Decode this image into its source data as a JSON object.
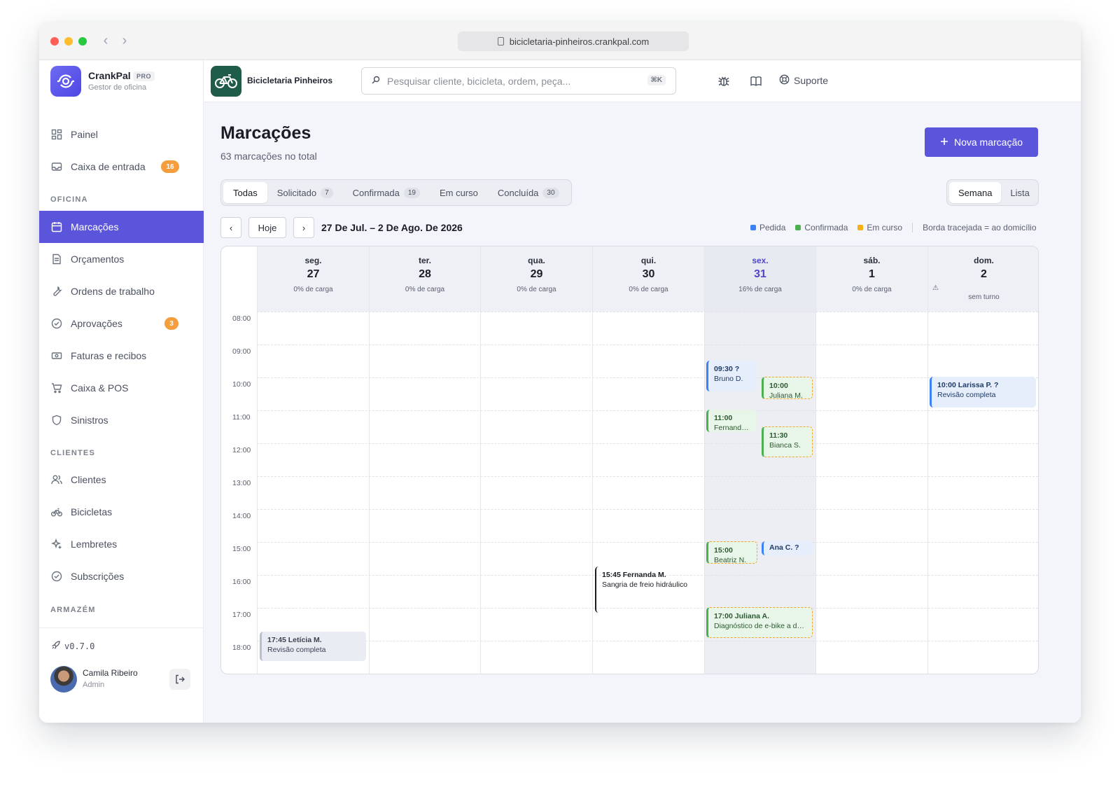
{
  "browser": {
    "url": "bicicletaria-pinheiros.crankpal.com"
  },
  "brand": {
    "name": "CrankPal",
    "tier": "PRO",
    "subtitle": "Gestor de oficina"
  },
  "sidebar": {
    "items": [
      {
        "label": "Painel",
        "icon": "dashboard-icon"
      },
      {
        "label": "Caixa de entrada",
        "icon": "inbox-icon",
        "badge": "16"
      },
      {
        "label": "Marcações",
        "icon": "calendar-icon",
        "active": true
      },
      {
        "label": "Orçamentos",
        "icon": "document-icon"
      },
      {
        "label": "Ordens de trabalho",
        "icon": "wrench-icon"
      },
      {
        "label": "Aprovações",
        "icon": "check-circle-icon",
        "badge": "3"
      },
      {
        "label": "Faturas e recibos",
        "icon": "banknote-icon"
      },
      {
        "label": "Caixa & POS",
        "icon": "cart-icon"
      },
      {
        "label": "Sinistros",
        "icon": "shield-icon"
      },
      {
        "label": "Clientes",
        "icon": "users-icon"
      },
      {
        "label": "Bicicletas",
        "icon": "bike-icon"
      },
      {
        "label": "Lembretes",
        "icon": "sparkles-icon"
      },
      {
        "label": "Subscrições",
        "icon": "check-circle-icon"
      }
    ],
    "sections": {
      "oficina": "OFICINA",
      "clientes": "CLIENTES",
      "armazem": "ARMAZÉM"
    },
    "version": "v0.7.0",
    "user": {
      "name": "Camila Ribeiro",
      "role": "Admin"
    }
  },
  "topbar": {
    "shop_name": "Bicicletaria Pinheiros",
    "search_placeholder": "Pesquisar cliente, bicicleta, ordem, peça...",
    "search_shortcut": "⌘K",
    "support_label": "Suporte"
  },
  "page": {
    "title": "Marcações",
    "subtitle": "63 marcações no total",
    "new_button": "Nova marcação",
    "filters": [
      {
        "label": "Todas",
        "active": true
      },
      {
        "label": "Solicitado",
        "count": "7"
      },
      {
        "label": "Confirmada",
        "count": "19"
      },
      {
        "label": "Em curso"
      },
      {
        "label": "Concluída",
        "count": "30"
      }
    ],
    "views": {
      "week": "Semana",
      "list": "Lista"
    },
    "today_button": "Hoje",
    "prev": "‹",
    "next": "›",
    "range": "27 De Jul. – 2 De Ago. De 2026",
    "legend": {
      "requested": "Pedida",
      "confirmed": "Confirmada",
      "in_progress": "Em curso",
      "note": "Borda tracejada = ao domicílio"
    },
    "colors": {
      "requested": "#3b82f6",
      "confirmed": "#4caf50",
      "in_progress": "#f5b014",
      "accent": "#5b55dc"
    }
  },
  "calendar": {
    "days": [
      {
        "name": "seg.",
        "date": "27",
        "load": "0% de carga"
      },
      {
        "name": "ter.",
        "date": "28",
        "load": "0% de carga"
      },
      {
        "name": "qua.",
        "date": "29",
        "load": "0% de carga"
      },
      {
        "name": "qui.",
        "date": "30",
        "load": "0% de carga"
      },
      {
        "name": "sex.",
        "date": "31",
        "load": "16% de carga",
        "today": true
      },
      {
        "name": "sáb.",
        "date": "1",
        "load": "0% de carga"
      },
      {
        "name": "dom.",
        "date": "2",
        "load": "sem turno",
        "warning": "⚠"
      }
    ],
    "hours": [
      "08:00",
      "09:00",
      "10:00",
      "11:00",
      "12:00",
      "13:00",
      "14:00",
      "15:00",
      "16:00",
      "17:00",
      "18:00"
    ],
    "events": [
      {
        "title": "17:45 Letícia M.",
        "sub": "Revisão completa"
      },
      {
        "title": "15:45 Fernanda M.",
        "sub": "Sangria de freio hidráulico"
      },
      {
        "title": "09:30 ?",
        "sub": "Bruno D."
      },
      {
        "title": "10:00",
        "sub": "Juliana M."
      },
      {
        "title": "11:00",
        "sub": "Fernanda ..."
      },
      {
        "title": "11:30",
        "sub": "Bianca S."
      },
      {
        "title": "15:00",
        "sub": "Beatriz N."
      },
      {
        "title": "Ana C. ?",
        "sub": ""
      },
      {
        "title": "17:00 Juliana A.",
        "sub": "Diagnóstico de e-bike a do..."
      },
      {
        "title": "10:00 Larissa P. ?",
        "sub": "Revisão completa"
      }
    ]
  }
}
